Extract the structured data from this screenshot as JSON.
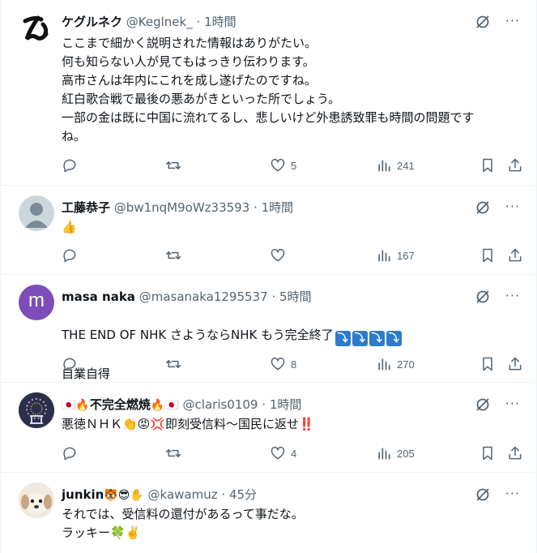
{
  "tweets": [
    {
      "display_name": "ケグルネク",
      "handle": "@Keglnek_",
      "time": "1時間",
      "text": "ここまで細かく説明された情報はありがたい。\n何も知らない人が見てもはっきり伝わります。\n高市さんは年内にこれを成し遂げたのですね。\n紅白歌合戦で最後の悪あがきといった所でしょう。\n一部の金は既に中国に流れてるし、悲しいけど外患誘致罪も時間の問題です\nね。",
      "likes": "5",
      "views": "241"
    },
    {
      "display_name": "工藤恭子",
      "handle": "@bw1nqM9oWz33593",
      "time": "1時間",
      "text": "👍",
      "likes": "",
      "views": "167"
    },
    {
      "display_name": "masa naka",
      "handle": "@masanaka1295537",
      "time": "5時間",
      "avatar_letter": "m",
      "text_main": "THE END OF NHK さようならNHK  もう完全終了",
      "text_arrows": [
        "⤵",
        "⤵",
        "⤵",
        "⤵"
      ],
      "text_line2": "自業自得",
      "likes": "8",
      "views": "270"
    },
    {
      "display_name_prefix": "🇯🇵🔥",
      "display_name": "不完全燃焼",
      "display_name_suffix": "🔥🇯🇵",
      "handle": "@claris0109",
      "time": "1時間",
      "text": "悪徳ＮＨＫ👏😡💢即刻受信料～国民に返せ‼️",
      "likes": "4",
      "views": "205"
    },
    {
      "display_name": "junkin",
      "display_name_suffix": "🐯😎✋",
      "handle": "@kawamuz",
      "time": "45分",
      "text": "それでは、受信料の還付があるって事だな。\nラッキー🍀✌️"
    }
  ],
  "dot": "·",
  "more_glyph": "···",
  "colors": {
    "text": "#0f1419",
    "muted": "#536471",
    "border": "#eff3f4",
    "accent": "#2e7bc9",
    "purple": "#7c4dbb"
  },
  "icons": [
    "grok-icon",
    "more-icon",
    "reply-icon",
    "retweet-icon",
    "like-icon",
    "views-icon",
    "bookmark-icon",
    "share-icon"
  ]
}
